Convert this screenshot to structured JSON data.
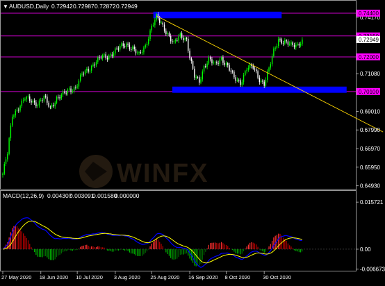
{
  "chart_data": [
    {
      "type": "candlestick",
      "title": "AUDUSD,Daily",
      "ohlc": {
        "open": "0.72942",
        "high": "0.72987",
        "low": "0.72872",
        "close": "0.72949"
      },
      "y_ticks": [
        "0.74170",
        "0.72949",
        "0.71080",
        "0.69010",
        "0.67990",
        "0.66970",
        "0.65950",
        "0.64930"
      ],
      "ylim": [
        0.648,
        0.7455
      ],
      "level_labels": [
        {
          "value": 0.744,
          "text": "0.74400"
        },
        {
          "value": 0.7315,
          "text": "0.73150"
        },
        {
          "value": 0.72,
          "text": "0.72000"
        },
        {
          "value": 0.701,
          "text": "0.70100"
        }
      ],
      "current_price": {
        "value": 0.72949,
        "text": "0.72949"
      },
      "zones": [
        {
          "x_from": 95,
          "x_to": 176,
          "y_from": 0.7412,
          "y_to": 0.7448,
          "color": "#0000ff"
        },
        {
          "x_from": 107,
          "x_to": 217,
          "y_from": 0.7003,
          "y_to": 0.7037,
          "color": "#0000ff"
        }
      ],
      "trendline": {
        "from": {
          "x": 97,
          "y": 0.7425
        },
        "to": {
          "x": 240,
          "y": 0.6788
        },
        "color": "#ffd700"
      },
      "x_labels": [
        {
          "index": 0,
          "text": "27 May 2020"
        },
        {
          "index": 24,
          "text": "18 Jun 2020"
        },
        {
          "index": 47,
          "text": "10 Jul 2020"
        },
        {
          "index": 71,
          "text": "3 Aug 2020"
        },
        {
          "index": 94,
          "text": "25 Aug 2020"
        },
        {
          "index": 118,
          "text": "16 Sep 2020"
        },
        {
          "index": 141,
          "text": "8 Oct 2020"
        },
        {
          "index": 165,
          "text": "30 Oct 2020"
        }
      ],
      "up_color": "#00ff00",
      "down_color": "#ffffff"
    },
    {
      "type": "macd",
      "title": "MACD(12,26,9)",
      "values": {
        "macd": "0.004307",
        "signal": "0.003091",
        "histogram": "0.001580",
        "extra": "0.000000"
      },
      "y_ticks": [
        "0.015721",
        "0.00",
        "-0.006673"
      ],
      "ylim": [
        -0.0072,
        0.016
      ],
      "macd_color": "#0000ff",
      "signal_color": "#ffff00"
    }
  ],
  "watermark": "WINFX"
}
